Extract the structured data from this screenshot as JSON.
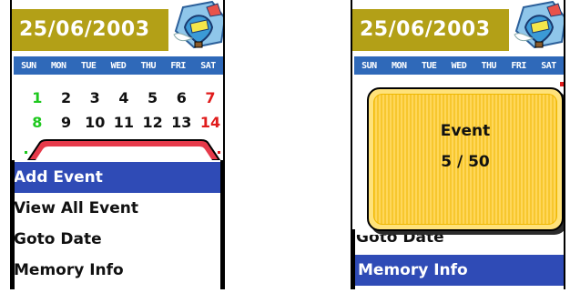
{
  "left_screen": {
    "date": "25/06/2003",
    "weekdays": [
      "SUN",
      "MON",
      "TUE",
      "WED",
      "THU",
      "FRI",
      "SAT"
    ],
    "calendar_rows": [
      [
        "1",
        "2",
        "3",
        "4",
        "5",
        "6",
        "7"
      ],
      [
        "8",
        "9",
        "10",
        "11",
        "12",
        "13",
        "14"
      ]
    ],
    "menu_items": [
      "Add Event",
      "View All Event",
      "Goto Date",
      "Memory Info"
    ],
    "selected_index": 0
  },
  "right_screen": {
    "date": "25/06/2003",
    "weekdays": [
      "SUN",
      "MON",
      "TUE",
      "WED",
      "THU",
      "FRI",
      "SAT"
    ],
    "popup_title": "Event",
    "popup_count": "5 / 50",
    "partial_menu_item": "Goto Date",
    "selected_menu_item": "Memory Info"
  },
  "colors": {
    "header_olive": "#b3a017",
    "weekday_blue": "#2f69b9",
    "selection_blue": "#2f4bb6",
    "sunday_green": "#1ec81e",
    "saturday_red": "#e01c1c",
    "popup_yellow": "#ffd75a"
  },
  "icons": [
    "balloon-icon"
  ]
}
